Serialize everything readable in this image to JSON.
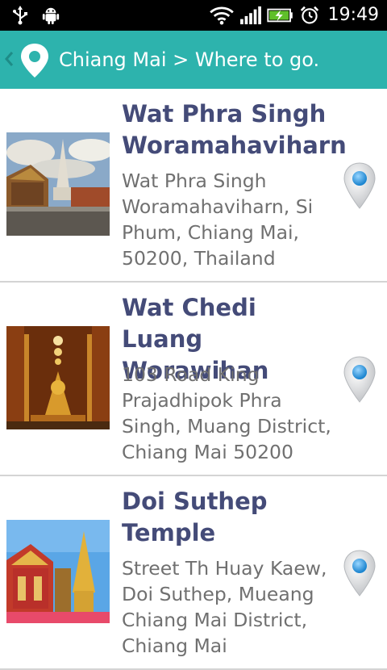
{
  "status_bar": {
    "time": "19:49",
    "icons": [
      "usb-icon",
      "android-debug-icon",
      "wifi-icon",
      "signal-icon",
      "battery-charging-icon",
      "alarm-icon"
    ]
  },
  "action_bar": {
    "title": "Chiang Mai > Where to go.",
    "colors": {
      "background": "#2db3ad",
      "text": "#ffffff"
    },
    "icons": [
      "back-chevron-icon",
      "map-pin-icon"
    ]
  },
  "places": [
    {
      "name": "Wat Phra Singh Woramahaviharn",
      "address": "Wat Phra Singh Woramahaviharn, Si Phum, Chiang Mai, 50200, Thailand"
    },
    {
      "name": "Wat Chedi Luang Worawihan",
      "address": "103 Road King Prajadhipok Phra Singh, Muang District, Chiang Mai 50200"
    },
    {
      "name": "Doi Suthep Temple",
      "address": "Street Th Huay Kaew, Doi Suthep, Mueang Chiang Mai District, Chiang Mai"
    }
  ],
  "colors": {
    "title_text": "#444b78",
    "address_text": "#707070",
    "divider": "#d4d4d4",
    "marker": "#4aa8e0"
  }
}
